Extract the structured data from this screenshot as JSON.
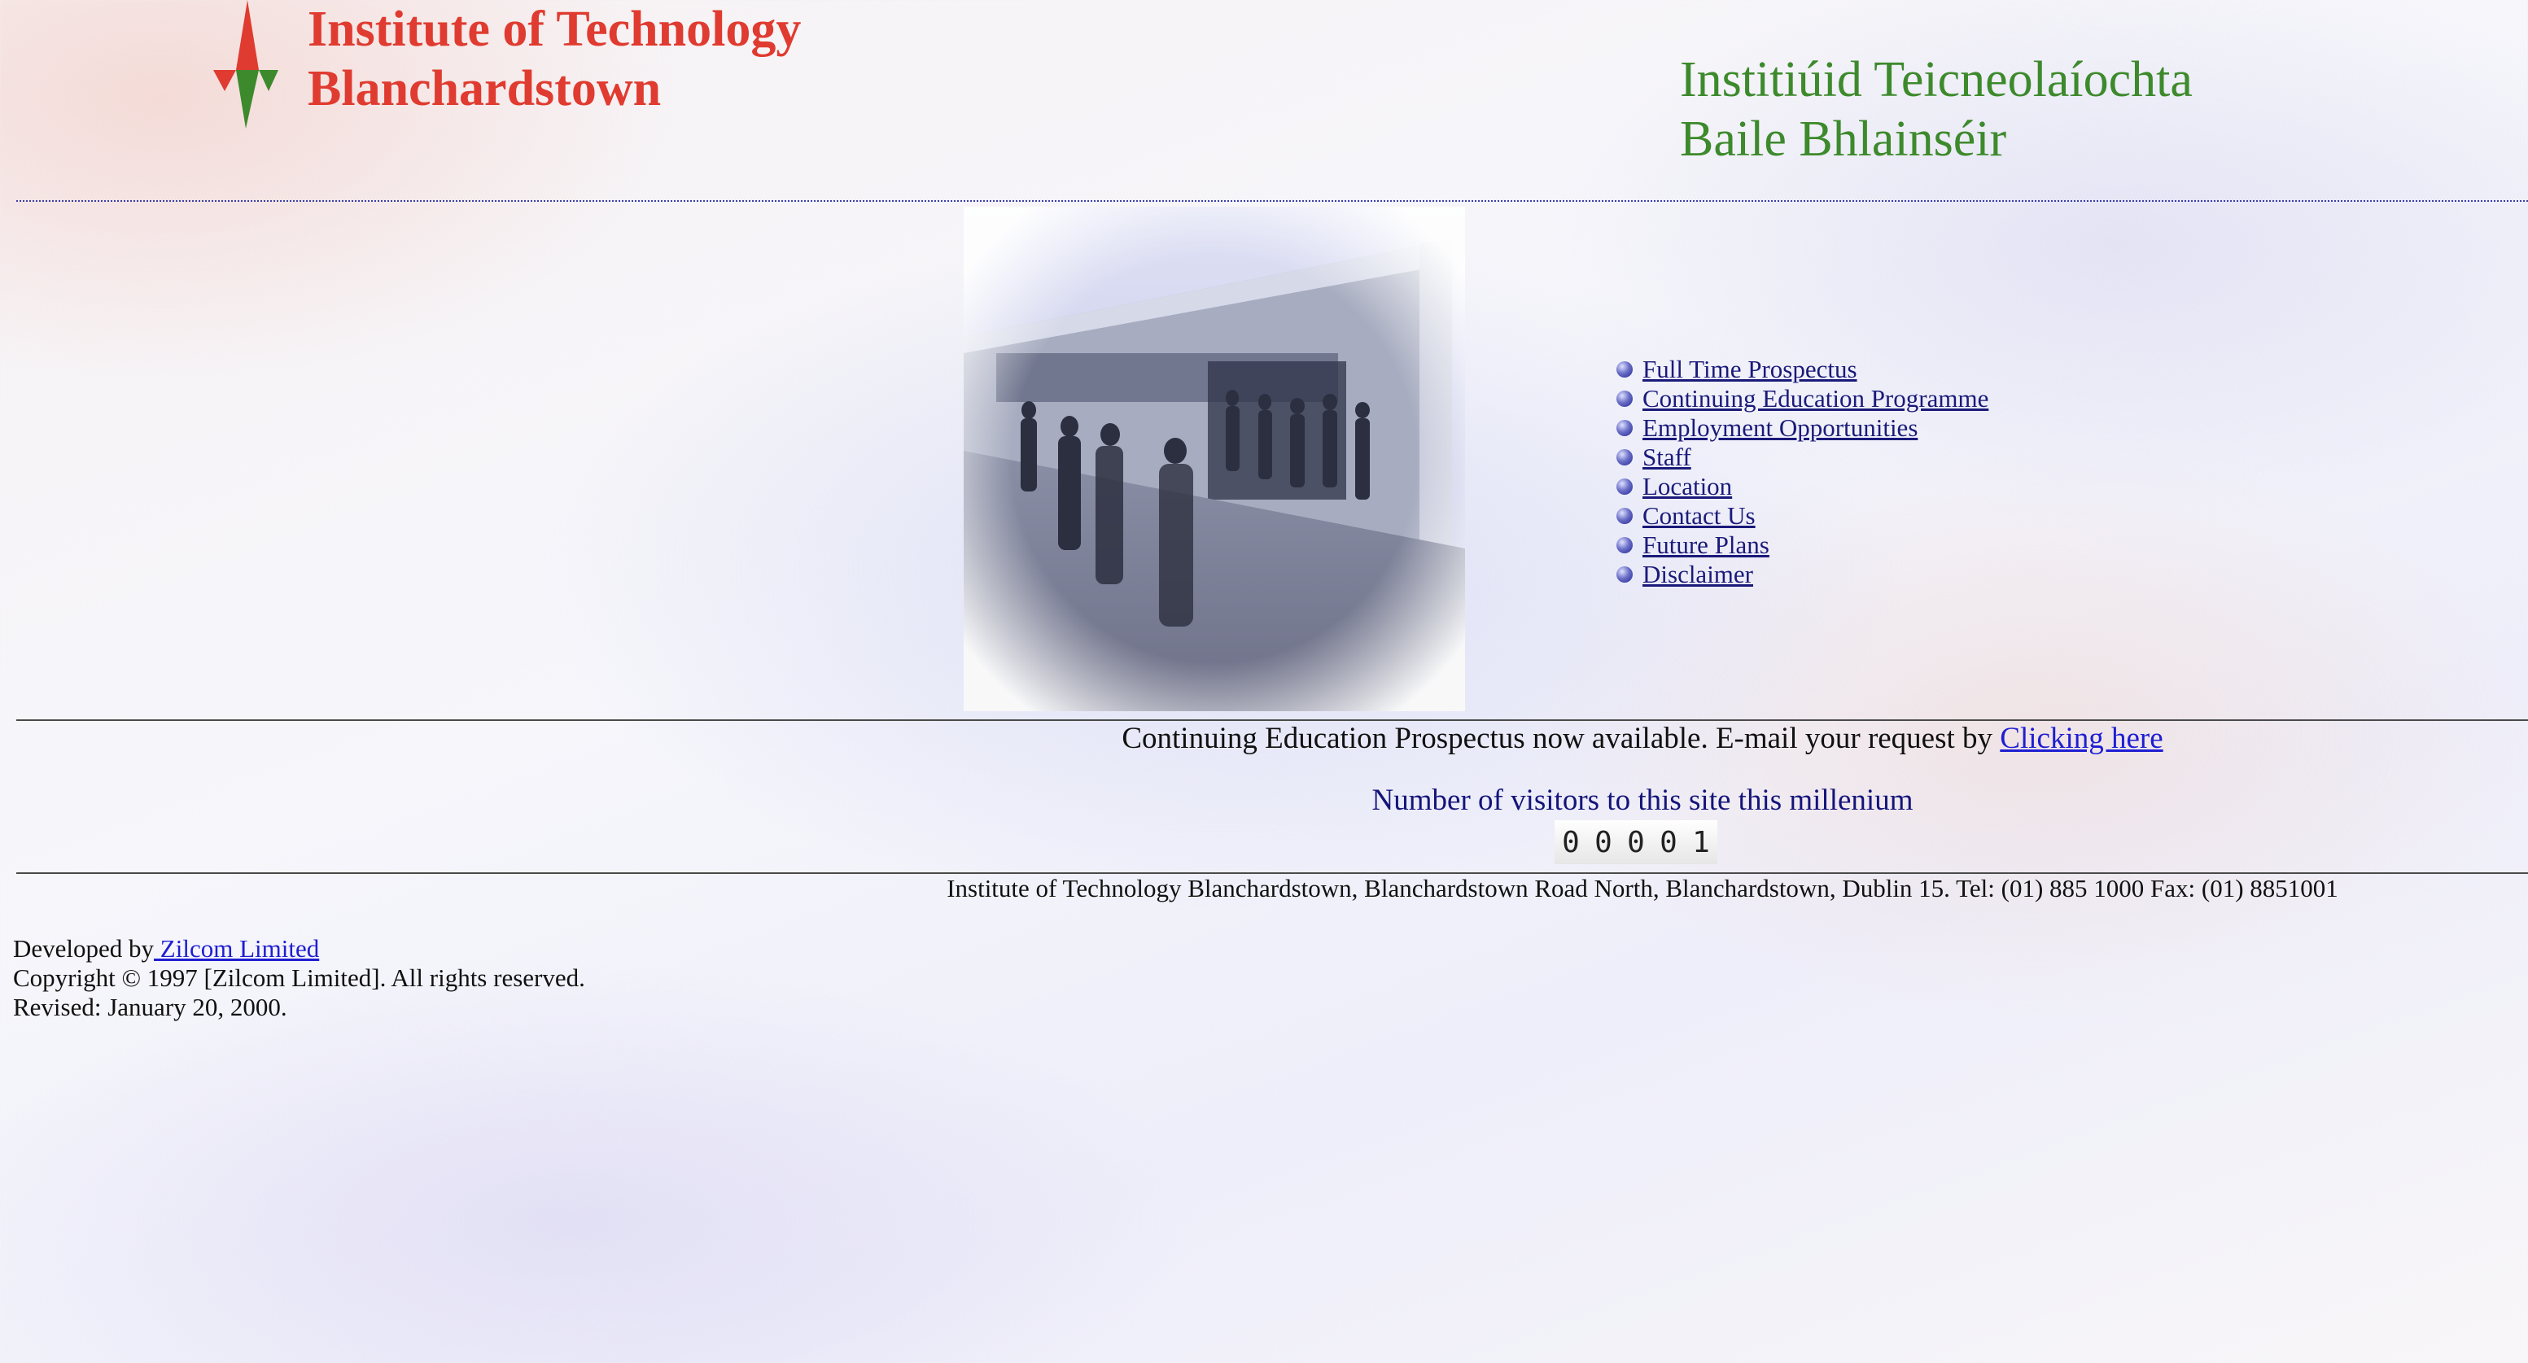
{
  "header": {
    "title_en_line1": "Institute of Technology",
    "title_en_line2": "Blanchardstown",
    "title_ga_line1": "Institiúid Teicneolaíochta",
    "title_ga_line2": "Baile Bhlainséir"
  },
  "menu": {
    "items": [
      {
        "label": "Full Time Prospectus"
      },
      {
        "label": "Continuing Education Programme"
      },
      {
        "label": "Employment Opportunities"
      },
      {
        "label": "Staff"
      },
      {
        "label": "Location"
      },
      {
        "label": "Contact Us"
      },
      {
        "label": "Future Plans"
      },
      {
        "label": "Disclaimer"
      }
    ]
  },
  "notice": {
    "text": "Continuing Education Prospectus now available. E-mail your request by ",
    "link": "Clicking here"
  },
  "visitors": {
    "label": "Number of visitors to this site this millenium",
    "digits": [
      "0",
      "0",
      "0",
      "0",
      "1"
    ]
  },
  "address": "Institute of Technology Blanchardstown, Blanchardstown Road North, Blanchardstown, Dublin 15. Tel: (01) 885 1000 Fax: (01) 8851001",
  "footer": {
    "developed_prefix": "Developed by",
    "developer_link": " Zilcom Limited",
    "copyright": "Copyright © 1997 [Zilcom Limited]. All rights reserved.",
    "revised": "Revised: January 20, 2000."
  },
  "colors": {
    "title_en": "#e03b30",
    "title_ga": "#3d8a2c",
    "link": "#1a1a7a",
    "visitors_text": "#14147a"
  },
  "icons": {
    "logo": "compass-logo-icon",
    "menu_bullet": "sphere-bullet-icon"
  }
}
